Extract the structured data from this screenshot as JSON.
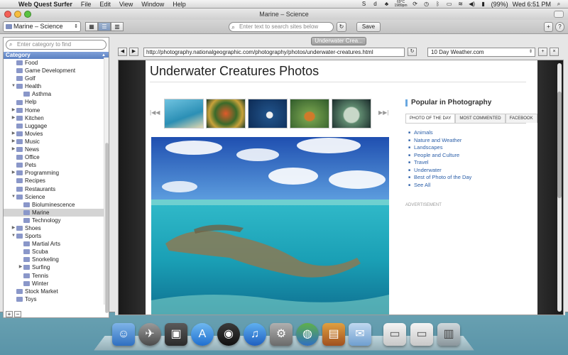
{
  "menubar": {
    "app_name": "Web Quest Surfer",
    "menus": [
      "File",
      "Edit",
      "View",
      "Window",
      "Help"
    ],
    "weather_temp": "69°C",
    "weather_pressure": "1989pm",
    "battery": "(99%)",
    "clock": "Wed 6:51 PM"
  },
  "window": {
    "title": "Marine – Science"
  },
  "toolbar": {
    "category_selected": "Marine – Science",
    "search_placeholder": "Enter text to search sites below",
    "save_label": "Save",
    "add_label": "+",
    "help_label": "?"
  },
  "sidebar": {
    "search_placeholder": "Enter category to find",
    "header": "Category",
    "items": [
      {
        "label": "Food",
        "level": 0,
        "expand": ""
      },
      {
        "label": "Game Development",
        "level": 0,
        "expand": ""
      },
      {
        "label": "Golf",
        "level": 0,
        "expand": ""
      },
      {
        "label": "Health",
        "level": 0,
        "expand": "▼"
      },
      {
        "label": "Asthma",
        "level": 1,
        "expand": ""
      },
      {
        "label": "Help",
        "level": 0,
        "expand": ""
      },
      {
        "label": "Home",
        "level": 0,
        "expand": "▶"
      },
      {
        "label": "Kitchen",
        "level": 0,
        "expand": "▶"
      },
      {
        "label": "Luggage",
        "level": 0,
        "expand": ""
      },
      {
        "label": "Movies",
        "level": 0,
        "expand": "▶"
      },
      {
        "label": "Music",
        "level": 0,
        "expand": "▶"
      },
      {
        "label": "News",
        "level": 0,
        "expand": "▶"
      },
      {
        "label": "Office",
        "level": 0,
        "expand": ""
      },
      {
        "label": "Pets",
        "level": 0,
        "expand": ""
      },
      {
        "label": "Programming",
        "level": 0,
        "expand": "▶"
      },
      {
        "label": "Recipes",
        "level": 0,
        "expand": ""
      },
      {
        "label": "Restaurants",
        "level": 0,
        "expand": ""
      },
      {
        "label": "Science",
        "level": 0,
        "expand": "▼"
      },
      {
        "label": "Bioluminescence",
        "level": 1,
        "expand": ""
      },
      {
        "label": "Marine",
        "level": 1,
        "expand": "",
        "selected": true
      },
      {
        "label": "Technology",
        "level": 1,
        "expand": ""
      },
      {
        "label": "Shoes",
        "level": 0,
        "expand": "▶"
      },
      {
        "label": "Sports",
        "level": 0,
        "expand": "▼"
      },
      {
        "label": "Martial Arts",
        "level": 1,
        "expand": ""
      },
      {
        "label": "Scuba",
        "level": 1,
        "expand": ""
      },
      {
        "label": "Snorkeling",
        "level": 1,
        "expand": ""
      },
      {
        "label": "Surfing",
        "level": 1,
        "expand": "▶"
      },
      {
        "label": "Tennis",
        "level": 1,
        "expand": ""
      },
      {
        "label": "Winter",
        "level": 1,
        "expand": ""
      },
      {
        "label": "Stock Market",
        "level": 0,
        "expand": ""
      },
      {
        "label": "Toys",
        "level": 0,
        "expand": ""
      }
    ],
    "add_label": "+",
    "remove_label": "−"
  },
  "browser": {
    "tab_label": "Underwater Crea...",
    "url": "http://photography.nationalgeographic.com/photography/photos/underwater-creatures.html",
    "bookmark_selected": "10 Day Weather.com",
    "back_icon": "◀",
    "forward_icon": "▶",
    "reload_icon": "↻"
  },
  "page": {
    "title": "Underwater Creatures Photos",
    "popular_title": "Popular in Photography",
    "popular_tabs": [
      "PHOTO OF THE DAY",
      "MOST COMMENTED",
      "FACEBOOK"
    ],
    "popular_links": [
      "Animals",
      "Nature and Weather",
      "Landscapes",
      "People and Culture",
      "Travel",
      "Underwater",
      "Best of Photo of the Day",
      "See All"
    ],
    "advertisement": "ADVERTISEMENT",
    "thumb_prev": "|◀◀",
    "thumb_next": "▶▶|"
  },
  "colors": {
    "accent": "#6aa8e0",
    "link": "#2a5ea8",
    "selection": "#d4d4d4",
    "header_blue": "#5a7fc0"
  }
}
